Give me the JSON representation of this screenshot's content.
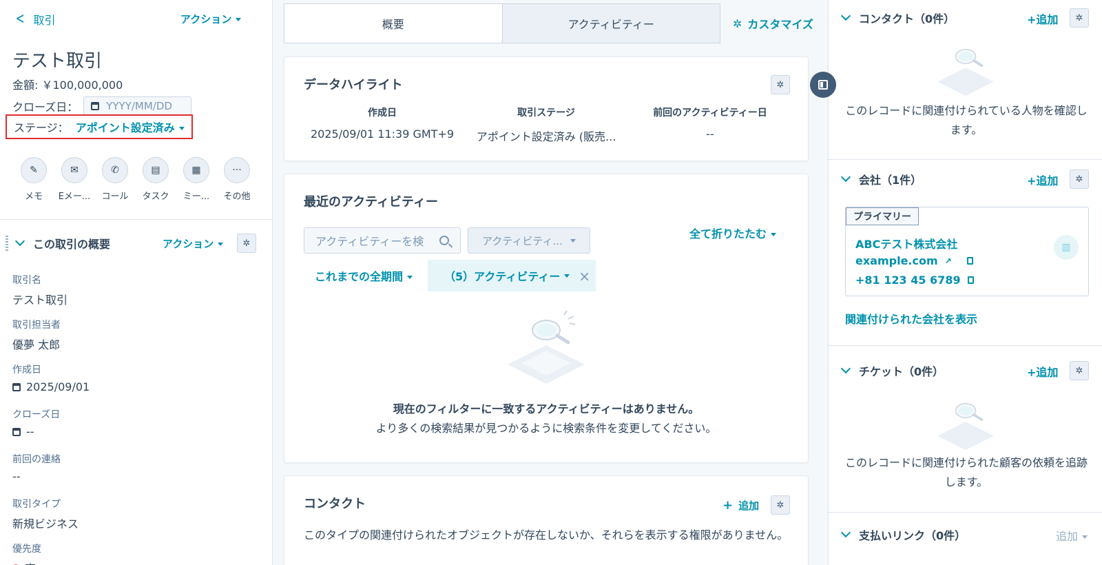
{
  "left": {
    "back_label": "取引",
    "top_action_label": "アクション",
    "record_title": "テスト取引",
    "amount": "金額: ￥100,000,000",
    "close_date_label": "クローズ日：",
    "close_date_placeholder": "YYYY/MM/DD",
    "stage_label": "ステージ：",
    "stage_value": "アポイント設定済み",
    "quick_actions": [
      {
        "label": "メモ",
        "icon": "✎"
      },
      {
        "label": "Eメー...",
        "icon": "✉"
      },
      {
        "label": "コール",
        "icon": "✆"
      },
      {
        "label": "タスク",
        "icon": "▤"
      },
      {
        "label": "ミー...",
        "icon": "▦"
      },
      {
        "label": "その他",
        "icon": "···"
      }
    ],
    "summary": {
      "title": "この取引の概要",
      "action_label": "アクション",
      "properties": [
        {
          "key": "取引名",
          "value": "テスト取引"
        },
        {
          "key": "取引担当者",
          "value": "優夢 太郎"
        },
        {
          "key": "作成日",
          "value": "2025/09/01"
        },
        {
          "key": "クローズ日",
          "value": "--"
        },
        {
          "key": "前回の連絡",
          "value": "--"
        },
        {
          "key": "取引タイプ",
          "value": "新規ビジネス"
        },
        {
          "key": "優先度",
          "value": "高"
        }
      ]
    }
  },
  "center": {
    "tabs": [
      {
        "label": "概要"
      },
      {
        "label": "アクティビティー"
      }
    ],
    "customize_label": "カスタマイズ",
    "highlights": {
      "title": "データハイライト",
      "items": [
        {
          "key": "作成日",
          "value": "2025/09/01 11:39 GMT+9"
        },
        {
          "key": "取引ステージ",
          "value": "アポイント設定済み (販売..."
        },
        {
          "key": "前回のアクティビティー日",
          "value": "--"
        }
      ]
    },
    "activity": {
      "title": "最近のアクティビティー",
      "search_placeholder": "アクティビティーを検",
      "filter_dropdown": "アクティビティ...",
      "collapse_all": "全て折りたたむ",
      "period": "これまでの全期間",
      "chip": "（5）アクティビティー",
      "chip_close": "×",
      "empty_title": "現在のフィルターに一致するアクティビティーはありません。",
      "empty_sub": "より多くの検索結果が見つかるように検索条件を変更してください。"
    },
    "contacts_card": {
      "title": "コンタクト",
      "add_label": "追加",
      "message": "このタイプの関連付けられたオブジェクトが存在しないか、それらを表示する権限がありません。"
    }
  },
  "right": {
    "contacts": {
      "title": "コンタクト（0件）",
      "add_label": "+追加",
      "empty": "このレコードに関連付けられている人物を確認します。"
    },
    "companies": {
      "title": "会社（1件）",
      "add_label": "+追加",
      "primary_tag": "プライマリー",
      "name": "ABCテスト株式会社",
      "website": "example.com",
      "phone": "+81 123 45 6789",
      "show_link": "関連付けられた会社を表示"
    },
    "tickets": {
      "title": "チケット（0件）",
      "add_label": "+追加",
      "empty": "このレコードに関連付けられた顧客の依頼を追跡します。"
    },
    "payment_links": {
      "title": "支払いリンク（0件）",
      "add_label": "追加"
    }
  },
  "colors": {
    "accent": "#0091ae",
    "highlight_border": "#e02b2b",
    "text": "#33475b",
    "chip_bg": "#e5f5f8"
  }
}
